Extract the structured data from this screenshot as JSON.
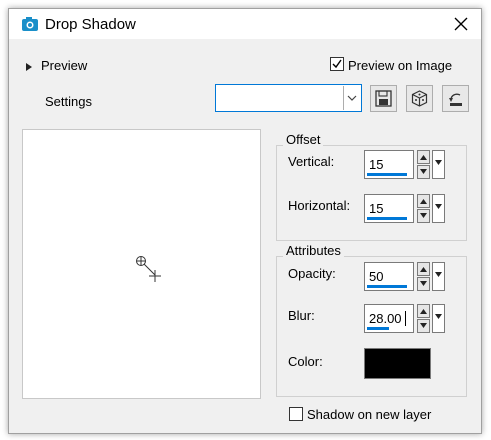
{
  "window": {
    "title": "Drop Shadow",
    "app_icon": "camera-icon",
    "close_icon": "close-icon"
  },
  "preview_section": {
    "label": "Preview",
    "expander_icon": "triangle-right-icon"
  },
  "preview_on_image": {
    "label": "Preview on Image",
    "checked": true
  },
  "settings": {
    "label": "Settings",
    "combo_value": "",
    "toolbar": [
      {
        "name": "save-preset-button",
        "icon": "floppy-disk-icon"
      },
      {
        "name": "randomize-button",
        "icon": "dice-icon"
      },
      {
        "name": "reset-button",
        "icon": "reset-arrow-icon"
      }
    ]
  },
  "offset": {
    "title": "Offset",
    "vertical": {
      "label": "Vertical:",
      "value": "15",
      "level_fraction": 0.9
    },
    "horizontal": {
      "label": "Horizontal:",
      "value": "15",
      "level_fraction": 0.9
    }
  },
  "attributes": {
    "title": "Attributes",
    "opacity": {
      "label": "Opacity:",
      "value": "50",
      "level_fraction": 0.5
    },
    "blur": {
      "label": "Blur:",
      "value": "28.00",
      "level_fraction": 0.28
    },
    "color": {
      "label": "Color:",
      "value": "#000000"
    }
  },
  "shadow_on_new_layer": {
    "label": "Shadow on new layer",
    "checked": false
  },
  "colors": {
    "accent": "#0078d7",
    "title_icon": "#1a8fc9"
  }
}
